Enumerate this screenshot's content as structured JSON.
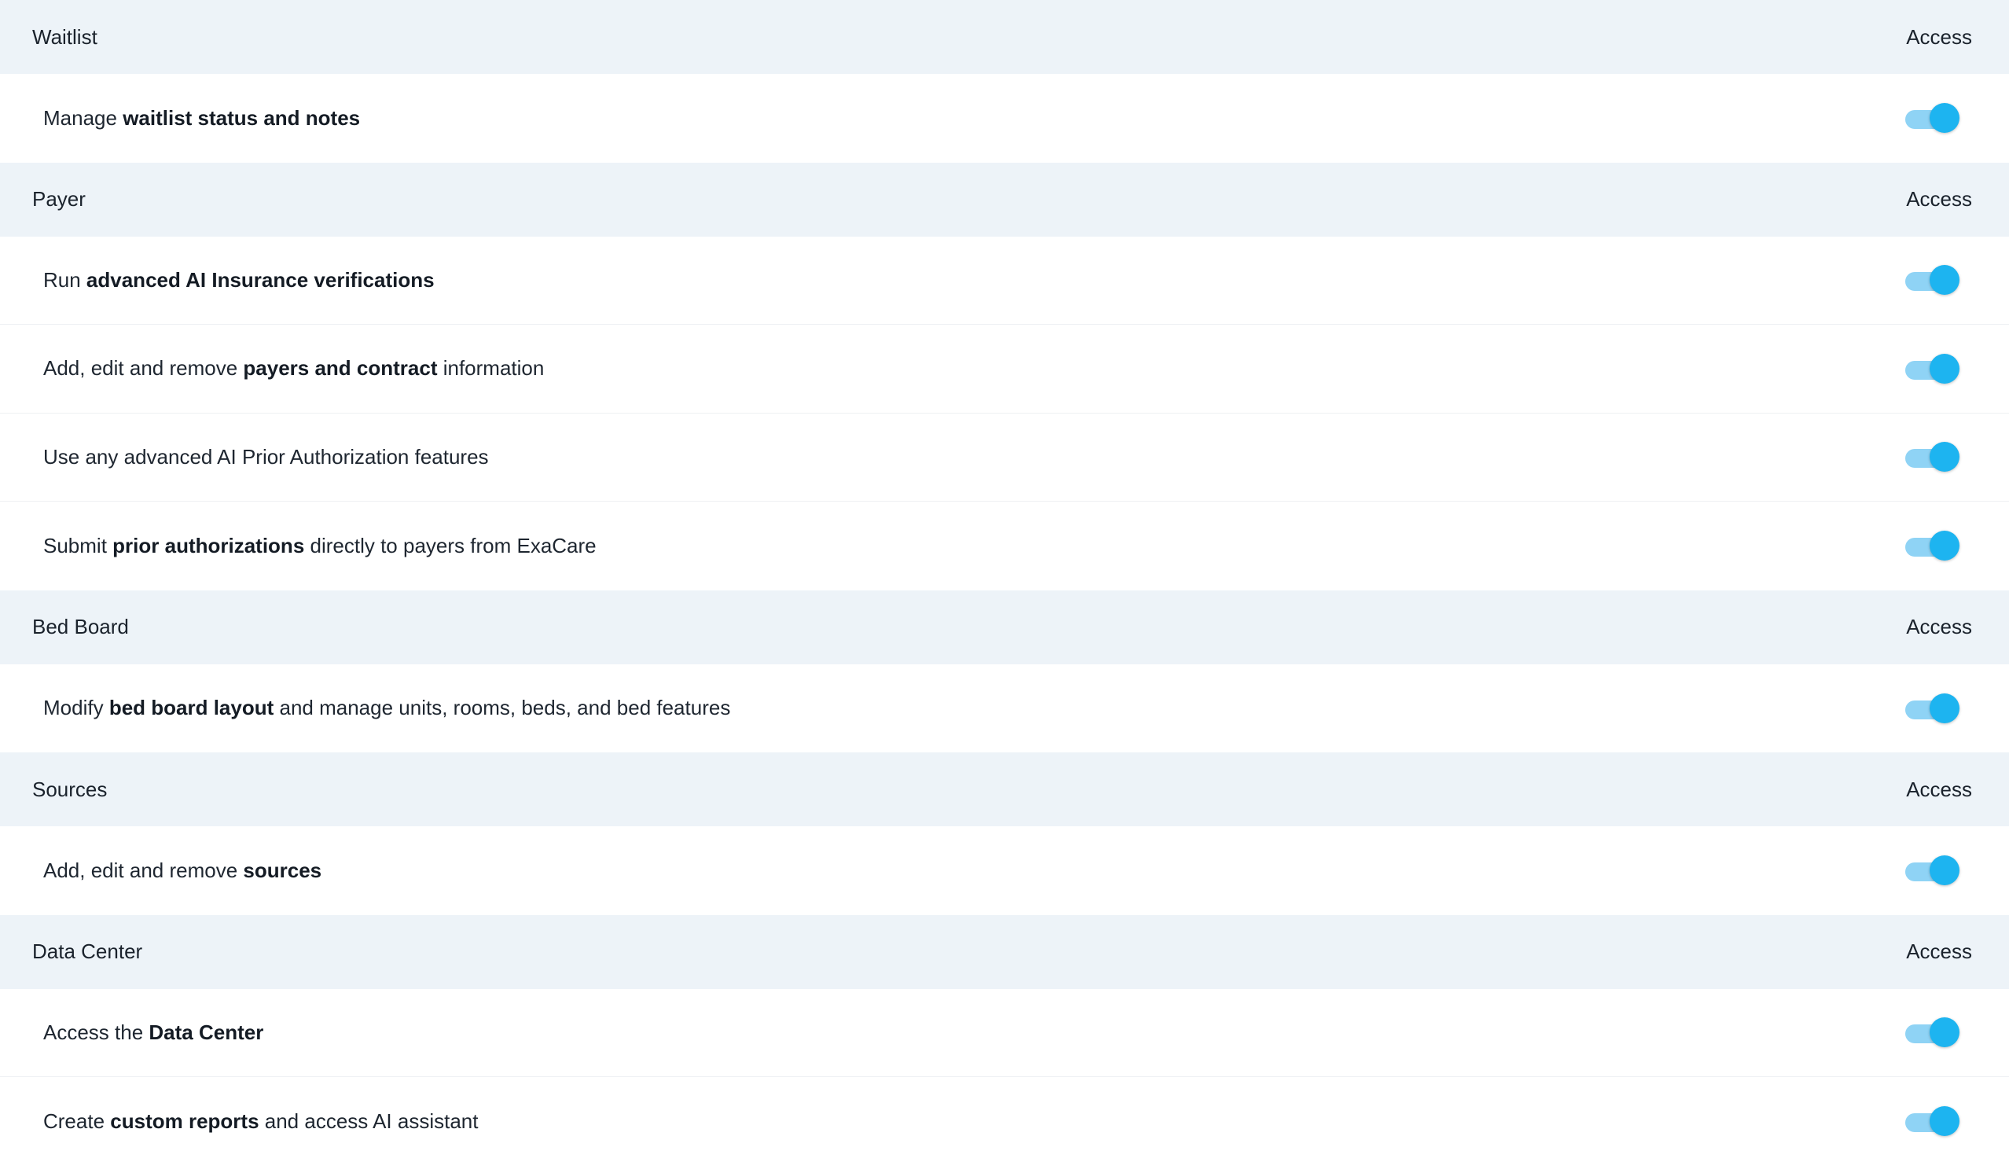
{
  "accent_color": "#1db4f0",
  "track_color": "#8fd3f5",
  "sections": [
    {
      "title": "Waitlist",
      "column_label": "Access",
      "rows": [
        {
          "parts": [
            {
              "text": "Manage ",
              "bold": false
            },
            {
              "text": "waitlist status and notes",
              "bold": true
            }
          ],
          "enabled": true
        }
      ]
    },
    {
      "title": "Payer",
      "column_label": "Access",
      "rows": [
        {
          "parts": [
            {
              "text": "Run ",
              "bold": false
            },
            {
              "text": "advanced AI Insurance verifications",
              "bold": true
            }
          ],
          "enabled": true
        },
        {
          "parts": [
            {
              "text": "Add, edit and remove ",
              "bold": false
            },
            {
              "text": "payers and contract",
              "bold": true
            },
            {
              "text": " information",
              "bold": false
            }
          ],
          "enabled": true
        },
        {
          "parts": [
            {
              "text": "Use any advanced AI Prior Authorization features",
              "bold": false
            }
          ],
          "enabled": true
        },
        {
          "parts": [
            {
              "text": "Submit ",
              "bold": false
            },
            {
              "text": "prior authorizations",
              "bold": true
            },
            {
              "text": " directly to payers from ExaCare",
              "bold": false
            }
          ],
          "enabled": true
        }
      ]
    },
    {
      "title": "Bed Board",
      "column_label": "Access",
      "rows": [
        {
          "parts": [
            {
              "text": "Modify ",
              "bold": false
            },
            {
              "text": "bed board layout",
              "bold": true
            },
            {
              "text": " and manage units, rooms, beds, and bed features",
              "bold": false
            }
          ],
          "enabled": true
        }
      ]
    },
    {
      "title": "Sources",
      "column_label": "Access",
      "rows": [
        {
          "parts": [
            {
              "text": "Add, edit and remove ",
              "bold": false
            },
            {
              "text": "sources",
              "bold": true
            }
          ],
          "enabled": true
        }
      ]
    },
    {
      "title": "Data Center",
      "column_label": "Access",
      "rows": [
        {
          "parts": [
            {
              "text": "Access the ",
              "bold": false
            },
            {
              "text": "Data Center",
              "bold": true
            }
          ],
          "enabled": true
        },
        {
          "parts": [
            {
              "text": "Create ",
              "bold": false
            },
            {
              "text": "custom reports",
              "bold": true
            },
            {
              "text": " and access AI assistant",
              "bold": false
            }
          ],
          "enabled": true
        }
      ]
    }
  ]
}
